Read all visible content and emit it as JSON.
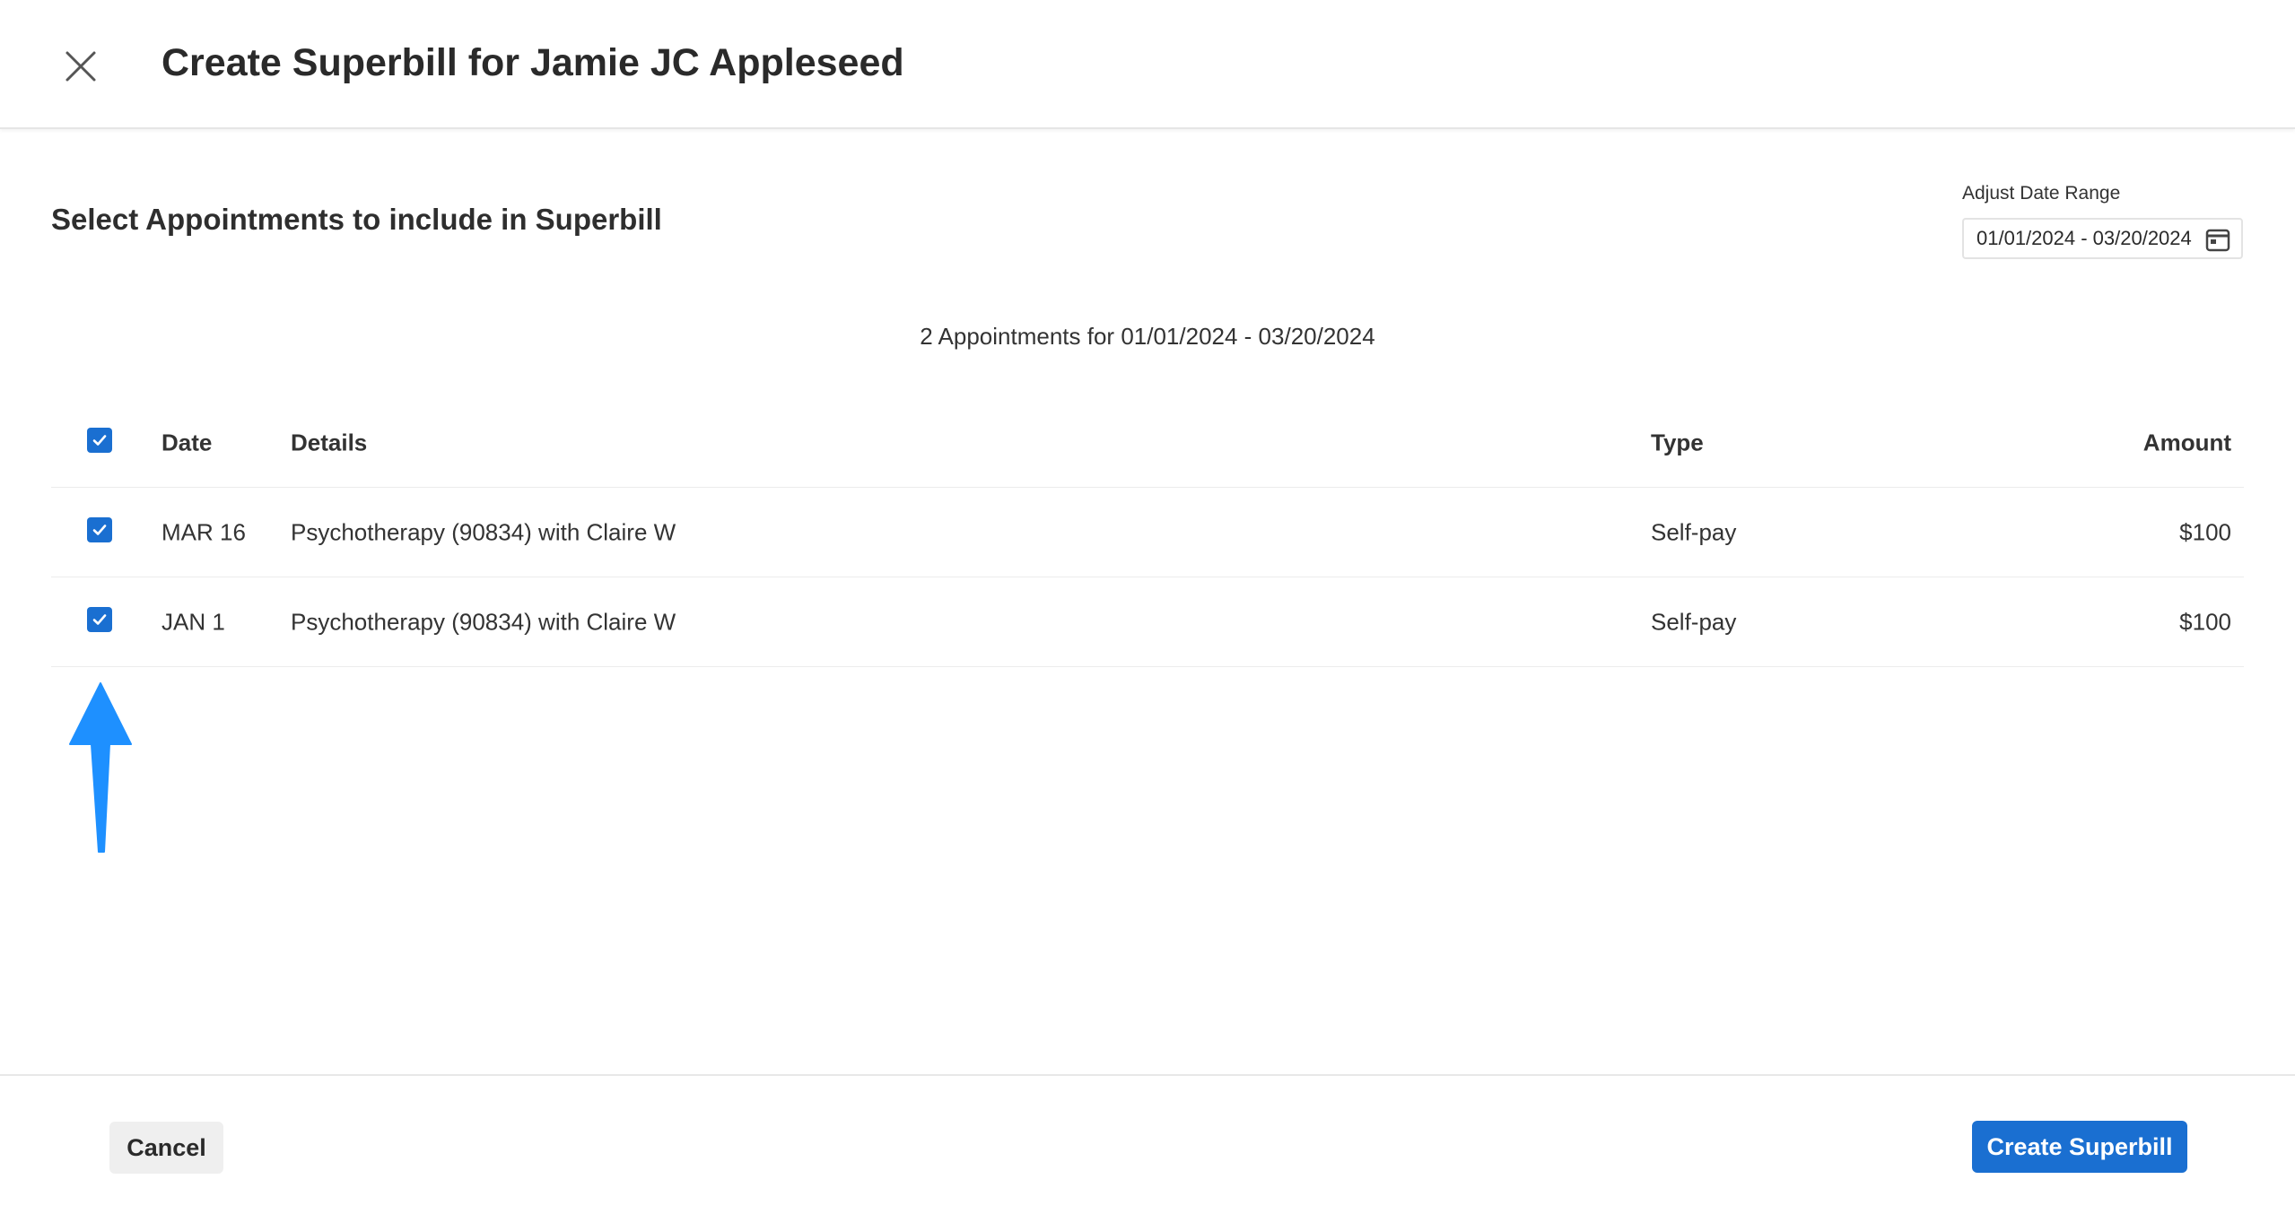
{
  "header": {
    "title": "Create Superbill for Jamie JC Appleseed",
    "close_icon": "close-icon"
  },
  "section": {
    "title": "Select Appointments to include in Superbill"
  },
  "date_range": {
    "label": "Adjust Date Range",
    "value": "01/01/2024 - 03/20/2024",
    "icon": "calendar-icon"
  },
  "summary": "2 Appointments for 01/01/2024 - 03/20/2024",
  "table": {
    "headers": {
      "date": "Date",
      "details": "Details",
      "type": "Type",
      "amount": "Amount"
    },
    "select_all_checked": true,
    "rows": [
      {
        "checked": true,
        "date": "MAR 16",
        "details": "Psychotherapy (90834) with Claire W",
        "type": "Self-pay",
        "amount": "$100"
      },
      {
        "checked": true,
        "date": "JAN 1",
        "details": "Psychotherapy (90834) with Claire W",
        "type": "Self-pay",
        "amount": "$100"
      }
    ]
  },
  "annotation": {
    "icon": "arrow-up-icon",
    "color": "#1e90ff"
  },
  "footer": {
    "cancel_label": "Cancel",
    "create_label": "Create Superbill"
  },
  "colors": {
    "primary": "#1a6fd1",
    "text": "#2f2f2f",
    "border": "#e5e5e5"
  }
}
